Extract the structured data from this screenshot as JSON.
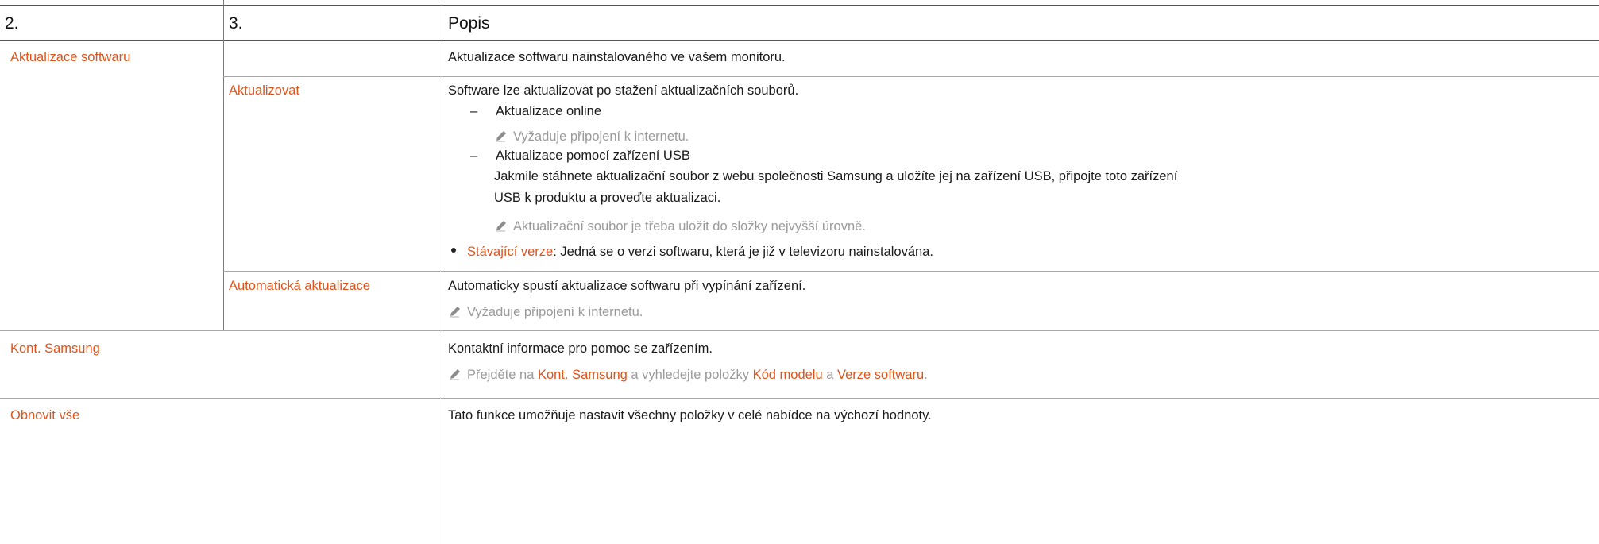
{
  "headers": {
    "col1": "2.",
    "col2": "3.",
    "col3": "Popis"
  },
  "colors": {
    "accent": "#e0541a",
    "note": "#9a9a9a"
  },
  "rows": {
    "update_software": {
      "label": "Aktualizace softwaru",
      "desc": "Aktualizace softwaru nainstalovaného ve vašem monitoru."
    },
    "update_now": {
      "label": "Aktualizovat",
      "desc": "Software lze aktualizovat po stažení aktualizačních souborů.",
      "online_dash": "–",
      "online": "Aktualizace online",
      "online_note": "Vyžaduje připojení k internetu.",
      "usb_dash": "–",
      "usb": "Aktualizace pomocí zařízení USB",
      "usb_desc_1": "Jakmile stáhnete aktualizační soubor z webu společnosti Samsung a uložíte jej na zařízení USB, připojte toto zařízení",
      "usb_desc_2": "USB k produktu a proveďte aktualizaci.",
      "usb_note": "Aktualizační soubor je třeba uložit do složky nejvyšší úrovně.",
      "current_version_label": "Stávající verze",
      "current_version_text": ": Jedná se o verzi softwaru, která je již v televizoru nainstalována."
    },
    "auto_update": {
      "label": "Automatická aktualizace",
      "desc": "Automaticky spustí aktualizace softwaru při vypínání zařízení.",
      "note": "Vyžaduje připojení k internetu."
    },
    "contact": {
      "label": "Kont. Samsung",
      "desc": "Kontaktní informace pro pomoc se zařízením.",
      "note_prefix": "Přejděte na ",
      "note_link1": "Kont. Samsung",
      "note_mid": " a vyhledejte položky ",
      "note_link2": "Kód modelu",
      "note_and": " a ",
      "note_link3": "Verze softwaru",
      "note_end": "."
    },
    "reset": {
      "label": "Obnovit vše",
      "desc": "Tato funkce umožňuje nastavit všechny položky v celé nabídce na výchozí hodnoty."
    }
  }
}
